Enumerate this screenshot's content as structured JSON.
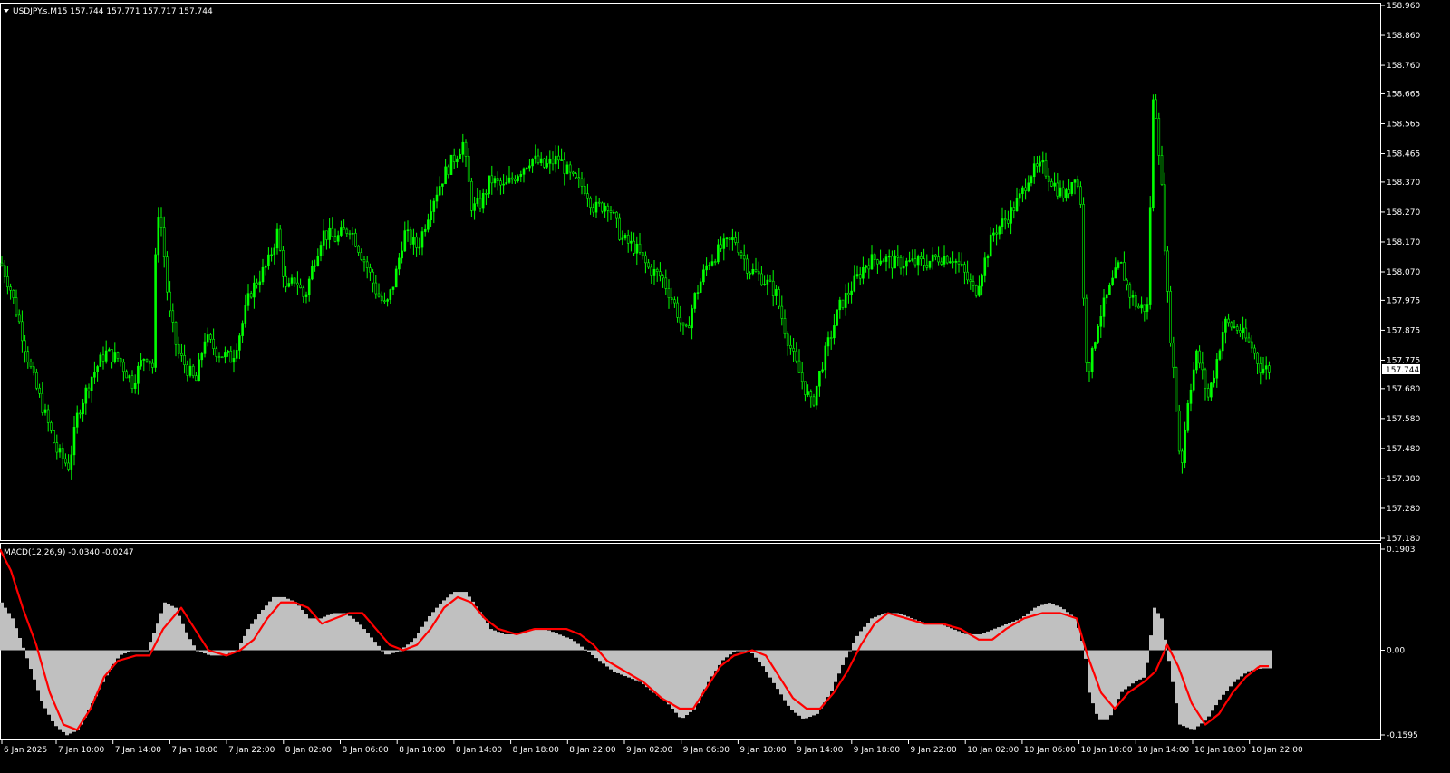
{
  "price_panel": {
    "header": "USDJPY.s,M15  157.744 157.771 157.717 157.744",
    "current_price": "157.744"
  },
  "macd_panel": {
    "header": "MACD(12,26,9) -0.0340 -0.0247"
  },
  "colors": {
    "background": "#000000",
    "candle": "#00ff00",
    "histogram": "#c0c0c0",
    "signal": "#ff0000",
    "frame": "#ffffff"
  },
  "chart_data": [
    {
      "type": "candlestick",
      "title": "USDJPY.s,M15",
      "ohlc_readout": {
        "open": 157.744,
        "high": 157.771,
        "low": 157.717,
        "close": 157.744
      },
      "y_axis_ticks": [
        "158.960",
        "158.860",
        "158.760",
        "158.665",
        "158.565",
        "158.465",
        "158.370",
        "158.270",
        "158.170",
        "158.070",
        "157.975",
        "157.875",
        "157.775",
        "157.680",
        "157.580",
        "157.480",
        "157.380",
        "157.280",
        "157.180"
      ],
      "ylim": [
        157.18,
        158.96
      ],
      "x_axis_ticks": [
        "6 Jan 2025",
        "7 Jan 10:00",
        "7 Jan 14:00",
        "7 Jan 18:00",
        "7 Jan 22:00",
        "8 Jan 02:00",
        "8 Jan 06:00",
        "8 Jan 10:00",
        "8 Jan 14:00",
        "8 Jan 18:00",
        "8 Jan 22:00",
        "9 Jan 02:00",
        "9 Jan 06:00",
        "9 Jan 10:00",
        "9 Jan 14:00",
        "9 Jan 18:00",
        "9 Jan 22:00",
        "10 Jan 02:00",
        "10 Jan 06:00",
        "10 Jan 10:00",
        "10 Jan 14:00",
        "10 Jan 18:00",
        "10 Jan 22:00"
      ],
      "close_path": [
        [
          0,
          158.1
        ],
        [
          10,
          158.02
        ],
        [
          22,
          157.88
        ],
        [
          35,
          157.72
        ],
        [
          48,
          157.6
        ],
        [
          62,
          157.47
        ],
        [
          75,
          157.42
        ],
        [
          85,
          157.6
        ],
        [
          100,
          157.72
        ],
        [
          115,
          157.8
        ],
        [
          130,
          157.78
        ],
        [
          145,
          157.7
        ],
        [
          160,
          157.8
        ],
        [
          168,
          157.75
        ],
        [
          172,
          158.3
        ],
        [
          178,
          158.2
        ],
        [
          185,
          157.95
        ],
        [
          195,
          157.8
        ],
        [
          205,
          157.75
        ],
        [
          215,
          157.7
        ],
        [
          225,
          157.85
        ],
        [
          240,
          157.8
        ],
        [
          255,
          157.78
        ],
        [
          265,
          157.88
        ],
        [
          275,
          158.0
        ],
        [
          285,
          158.05
        ],
        [
          295,
          158.1
        ],
        [
          305,
          158.2
        ],
        [
          315,
          158.0
        ],
        [
          325,
          158.05
        ],
        [
          335,
          157.98
        ],
        [
          345,
          158.1
        ],
        [
          355,
          158.2
        ],
        [
          370,
          158.18
        ],
        [
          385,
          158.22
        ],
        [
          395,
          158.15
        ],
        [
          405,
          158.08
        ],
        [
          415,
          158.0
        ],
        [
          425,
          157.95
        ],
        [
          435,
          158.05
        ],
        [
          445,
          158.2
        ],
        [
          460,
          158.15
        ],
        [
          475,
          158.3
        ],
        [
          490,
          158.4
        ],
        [
          500,
          158.45
        ],
        [
          510,
          158.5
        ],
        [
          520,
          158.28
        ],
        [
          530,
          158.3
        ],
        [
          540,
          158.38
        ],
        [
          555,
          158.35
        ],
        [
          570,
          158.4
        ],
        [
          585,
          158.45
        ],
        [
          600,
          158.42
        ],
        [
          615,
          158.45
        ],
        [
          630,
          158.38
        ],
        [
          645,
          158.35
        ],
        [
          655,
          158.28
        ],
        [
          670,
          158.3
        ],
        [
          685,
          158.18
        ],
        [
          700,
          158.15
        ],
        [
          715,
          158.08
        ],
        [
          730,
          158.05
        ],
        [
          745,
          157.95
        ],
        [
          755,
          157.85
        ],
        [
          765,
          157.98
        ],
        [
          780,
          158.1
        ],
        [
          795,
          158.15
        ],
        [
          810,
          158.18
        ],
        [
          825,
          158.08
        ],
        [
          840,
          158.05
        ],
        [
          855,
          158.0
        ],
        [
          865,
          157.88
        ],
        [
          875,
          157.78
        ],
        [
          885,
          157.7
        ],
        [
          895,
          157.62
        ],
        [
          905,
          157.75
        ],
        [
          915,
          157.85
        ],
        [
          925,
          157.95
        ],
        [
          935,
          158.0
        ],
        [
          945,
          158.05
        ],
        [
          955,
          158.1
        ],
        [
          970,
          158.12
        ],
        [
          985,
          158.1
        ],
        [
          1000,
          158.1
        ],
        [
          1020,
          158.1
        ],
        [
          1035,
          158.12
        ],
        [
          1050,
          158.12
        ],
        [
          1060,
          158.08
        ],
        [
          1075,
          158.0
        ],
        [
          1085,
          158.1
        ],
        [
          1095,
          158.2
        ],
        [
          1110,
          158.25
        ],
        [
          1125,
          158.32
        ],
        [
          1135,
          158.4
        ],
        [
          1150,
          158.42
        ],
        [
          1165,
          158.35
        ],
        [
          1175,
          158.32
        ],
        [
          1185,
          158.4
        ],
        [
          1192,
          158.3
        ],
        [
          1196,
          157.8
        ],
        [
          1202,
          157.75
        ],
        [
          1210,
          157.9
        ],
        [
          1222,
          158.0
        ],
        [
          1235,
          158.1
        ],
        [
          1245,
          158.0
        ],
        [
          1255,
          157.95
        ],
        [
          1265,
          157.95
        ],
        [
          1272,
          158.7
        ],
        [
          1280,
          158.4
        ],
        [
          1288,
          157.95
        ],
        [
          1295,
          157.7
        ],
        [
          1302,
          157.4
        ],
        [
          1310,
          157.65
        ],
        [
          1320,
          157.8
        ],
        [
          1332,
          157.65
        ],
        [
          1340,
          157.75
        ],
        [
          1350,
          157.9
        ],
        [
          1365,
          157.88
        ],
        [
          1380,
          157.82
        ],
        [
          1390,
          157.75
        ],
        [
          1400,
          157.744
        ]
      ]
    },
    {
      "type": "line+histogram",
      "title": "MACD(12,26,9)",
      "macd": -0.034,
      "signal": -0.0247,
      "y_axis_ticks": [
        "0.1903",
        "0.00",
        "-0.1595"
      ],
      "ylim": [
        -0.1595,
        0.1903
      ],
      "macd_histogram": [
        [
          0,
          0.09
        ],
        [
          12,
          0.06
        ],
        [
          25,
          0.0
        ],
        [
          35,
          -0.05
        ],
        [
          45,
          -0.1
        ],
        [
          58,
          -0.14
        ],
        [
          72,
          -0.16
        ],
        [
          85,
          -0.15
        ],
        [
          100,
          -0.1
        ],
        [
          115,
          -0.05
        ],
        [
          130,
          -0.01
        ],
        [
          145,
          0.0
        ],
        [
          160,
          0.0
        ],
        [
          170,
          0.04
        ],
        [
          180,
          0.09
        ],
        [
          192,
          0.08
        ],
        [
          205,
          0.03
        ],
        [
          215,
          0.0
        ],
        [
          230,
          -0.01
        ],
        [
          245,
          -0.01
        ],
        [
          260,
          0.0
        ],
        [
          272,
          0.04
        ],
        [
          285,
          0.07
        ],
        [
          300,
          0.1
        ],
        [
          312,
          0.1
        ],
        [
          325,
          0.09
        ],
        [
          340,
          0.06
        ],
        [
          352,
          0.06
        ],
        [
          365,
          0.07
        ],
        [
          380,
          0.07
        ],
        [
          395,
          0.05
        ],
        [
          410,
          0.02
        ],
        [
          425,
          -0.01
        ],
        [
          440,
          0.0
        ],
        [
          455,
          0.02
        ],
        [
          470,
          0.06
        ],
        [
          485,
          0.09
        ],
        [
          500,
          0.11
        ],
        [
          512,
          0.11
        ],
        [
          525,
          0.08
        ],
        [
          540,
          0.04
        ],
        [
          555,
          0.03
        ],
        [
          570,
          0.03
        ],
        [
          585,
          0.04
        ],
        [
          600,
          0.04
        ],
        [
          615,
          0.03
        ],
        [
          630,
          0.02
        ],
        [
          645,
          0.0
        ],
        [
          660,
          -0.02
        ],
        [
          675,
          -0.04
        ],
        [
          690,
          -0.05
        ],
        [
          705,
          -0.06
        ],
        [
          720,
          -0.08
        ],
        [
          735,
          -0.1
        ],
        [
          750,
          -0.13
        ],
        [
          765,
          -0.11
        ],
        [
          780,
          -0.06
        ],
        [
          795,
          -0.02
        ],
        [
          810,
          0.0
        ],
        [
          825,
          0.0
        ],
        [
          840,
          -0.03
        ],
        [
          855,
          -0.07
        ],
        [
          870,
          -0.11
        ],
        [
          885,
          -0.13
        ],
        [
          900,
          -0.12
        ],
        [
          915,
          -0.08
        ],
        [
          930,
          -0.02
        ],
        [
          945,
          0.03
        ],
        [
          960,
          0.06
        ],
        [
          975,
          0.07
        ],
        [
          990,
          0.07
        ],
        [
          1005,
          0.06
        ],
        [
          1020,
          0.05
        ],
        [
          1035,
          0.05
        ],
        [
          1050,
          0.04
        ],
        [
          1065,
          0.03
        ],
        [
          1080,
          0.03
        ],
        [
          1095,
          0.04
        ],
        [
          1110,
          0.05
        ],
        [
          1125,
          0.06
        ],
        [
          1140,
          0.08
        ],
        [
          1155,
          0.09
        ],
        [
          1170,
          0.08
        ],
        [
          1185,
          0.06
        ],
        [
          1195,
          0.0
        ],
        [
          1200,
          -0.08
        ],
        [
          1210,
          -0.13
        ],
        [
          1222,
          -0.13
        ],
        [
          1235,
          -0.08
        ],
        [
          1250,
          -0.06
        ],
        [
          1262,
          -0.05
        ],
        [
          1272,
          0.08
        ],
        [
          1280,
          0.06
        ],
        [
          1288,
          -0.02
        ],
        [
          1300,
          -0.14
        ],
        [
          1315,
          -0.15
        ],
        [
          1330,
          -0.13
        ],
        [
          1345,
          -0.09
        ],
        [
          1360,
          -0.06
        ],
        [
          1375,
          -0.04
        ],
        [
          1390,
          -0.034
        ],
        [
          1400,
          -0.034
        ]
      ],
      "signal_line": [
        [
          0,
          0.19
        ],
        [
          12,
          0.15
        ],
        [
          25,
          0.08
        ],
        [
          40,
          0.01
        ],
        [
          55,
          -0.08
        ],
        [
          70,
          -0.14
        ],
        [
          85,
          -0.15
        ],
        [
          100,
          -0.11
        ],
        [
          115,
          -0.05
        ],
        [
          130,
          -0.02
        ],
        [
          150,
          -0.01
        ],
        [
          165,
          -0.01
        ],
        [
          180,
          0.04
        ],
        [
          200,
          0.08
        ],
        [
          215,
          0.04
        ],
        [
          230,
          0.0
        ],
        [
          250,
          -0.01
        ],
        [
          265,
          0.0
        ],
        [
          280,
          0.02
        ],
        [
          295,
          0.06
        ],
        [
          310,
          0.09
        ],
        [
          325,
          0.09
        ],
        [
          340,
          0.08
        ],
        [
          355,
          0.05
        ],
        [
          370,
          0.06
        ],
        [
          385,
          0.07
        ],
        [
          400,
          0.07
        ],
        [
          415,
          0.04
        ],
        [
          430,
          0.01
        ],
        [
          445,
          0.0
        ],
        [
          460,
          0.01
        ],
        [
          475,
          0.04
        ],
        [
          490,
          0.08
        ],
        [
          505,
          0.1
        ],
        [
          520,
          0.09
        ],
        [
          535,
          0.06
        ],
        [
          550,
          0.04
        ],
        [
          570,
          0.03
        ],
        [
          590,
          0.04
        ],
        [
          610,
          0.04
        ],
        [
          625,
          0.04
        ],
        [
          640,
          0.03
        ],
        [
          655,
          0.01
        ],
        [
          670,
          -0.02
        ],
        [
          690,
          -0.04
        ],
        [
          710,
          -0.06
        ],
        [
          730,
          -0.09
        ],
        [
          750,
          -0.11
        ],
        [
          765,
          -0.11
        ],
        [
          780,
          -0.07
        ],
        [
          795,
          -0.03
        ],
        [
          810,
          -0.01
        ],
        [
          830,
          0.0
        ],
        [
          845,
          -0.01
        ],
        [
          860,
          -0.05
        ],
        [
          875,
          -0.09
        ],
        [
          890,
          -0.11
        ],
        [
          905,
          -0.11
        ],
        [
          920,
          -0.08
        ],
        [
          935,
          -0.04
        ],
        [
          950,
          0.01
        ],
        [
          965,
          0.05
        ],
        [
          980,
          0.07
        ],
        [
          1000,
          0.06
        ],
        [
          1020,
          0.05
        ],
        [
          1040,
          0.05
        ],
        [
          1060,
          0.04
        ],
        [
          1080,
          0.02
        ],
        [
          1095,
          0.02
        ],
        [
          1110,
          0.04
        ],
        [
          1130,
          0.06
        ],
        [
          1150,
          0.07
        ],
        [
          1170,
          0.07
        ],
        [
          1188,
          0.06
        ],
        [
          1200,
          -0.01
        ],
        [
          1215,
          -0.08
        ],
        [
          1230,
          -0.11
        ],
        [
          1245,
          -0.08
        ],
        [
          1262,
          -0.06
        ],
        [
          1275,
          -0.04
        ],
        [
          1288,
          0.01
        ],
        [
          1300,
          -0.03
        ],
        [
          1315,
          -0.1
        ],
        [
          1330,
          -0.14
        ],
        [
          1345,
          -0.12
        ],
        [
          1360,
          -0.08
        ],
        [
          1375,
          -0.05
        ],
        [
          1390,
          -0.03
        ],
        [
          1400,
          -0.03
        ]
      ]
    }
  ]
}
